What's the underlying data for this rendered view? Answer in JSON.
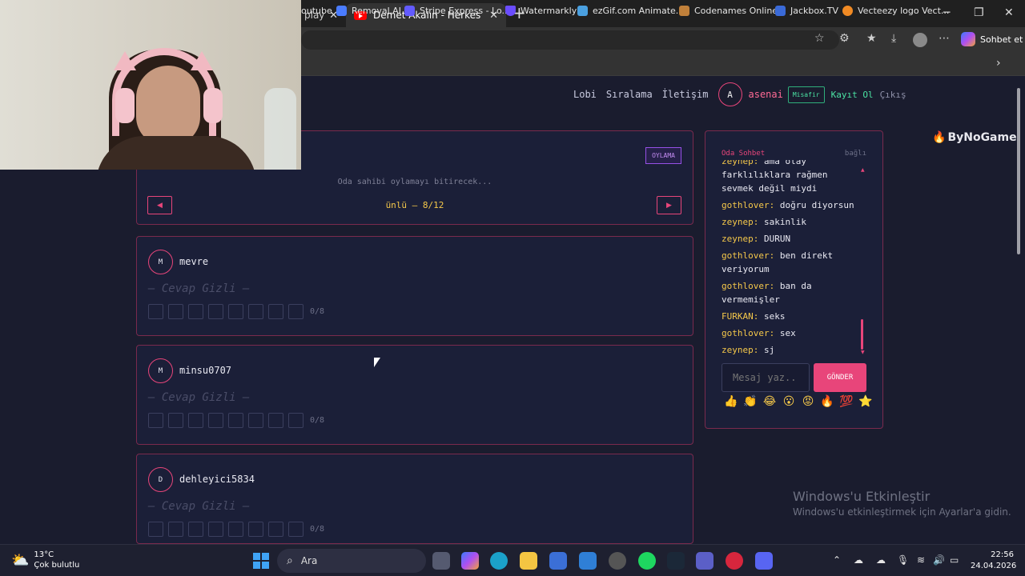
{
  "browser": {
    "tabs": [
      {
        "title": "player"
      },
      {
        "title": "Demet Akalın - Herkes Hak Ettiği G"
      }
    ],
    "copilot_label": "Sohbet et",
    "bookmarks": [
      {
        "label": "outube",
        "color": "#ff0000"
      },
      {
        "label": "Removal.AI",
        "color": "#4a7cff"
      },
      {
        "label": "Stripe Express - Lo...",
        "color": "#635bff"
      },
      {
        "label": "Watermarkly",
        "color": "#6a4cff"
      },
      {
        "label": "ezGif.com Animate...",
        "color": "#4aa0e0"
      },
      {
        "label": "Codenames Online",
        "color": "#c0803a"
      },
      {
        "label": "Jackbox.TV",
        "color": "#3a6ad8"
      },
      {
        "label": "Vecteezy logo Vect...",
        "color": "#f08a24"
      }
    ]
  },
  "nav": {
    "links": [
      "Lobi",
      "Sıralama",
      "İletişim"
    ],
    "avatar_letter": "A",
    "username": "asenai",
    "guest_badge": "Misafir",
    "register": "Kayıt Ol",
    "logout": "Çıkış",
    "logo_text": "ByNoGame"
  },
  "voting": {
    "badge": "OYLAMA",
    "status": "Oda sahibi oylamayı bitirecek...",
    "prev": "◀",
    "next": "▶",
    "counter": "ünlü — 8/12"
  },
  "players": [
    {
      "initial": "M",
      "name": "mevre",
      "answer": "— Cevap Gizli —",
      "progress": "0/8"
    },
    {
      "initial": "M",
      "name": "minsu0707",
      "answer": "— Cevap Gizli —",
      "progress": "0/8"
    },
    {
      "initial": "D",
      "name": "dehleyici5834",
      "answer": "— Cevap Gizli —",
      "progress": "0/8"
    }
  ],
  "chat": {
    "title": "Oda Sohbet",
    "status": "bağlı",
    "messages": [
      {
        "user": "zeynep:",
        "text": "ama olay farklılıklara rağmen sevmek değil miydi"
      },
      {
        "user": "gothlover:",
        "text": "doğru diyorsun"
      },
      {
        "user": "zeynep:",
        "text": "sakinlik"
      },
      {
        "user": "zeynep:",
        "text": "DURUN"
      },
      {
        "user": "gothlover:",
        "text": "ben direkt veriyorum"
      },
      {
        "user": "gothlover:",
        "text": "ban da vermemişler"
      },
      {
        "user": "FURKAN:",
        "text": "seks"
      },
      {
        "user": "gothlover:",
        "text": "sex"
      },
      {
        "user": "zeynep:",
        "text": "sj"
      }
    ],
    "input_placeholder": "Mesaj yaz..",
    "send_label": "GÖNDER",
    "emojis": [
      "👍",
      "👏",
      "😂",
      "😮",
      "😡",
      "🔥",
      "💯",
      "⭐"
    ]
  },
  "watermark": {
    "title": "Windows'u Etkinleştir",
    "subtitle": "Windows'u etkinleştirmek için Ayarlar'a gidin."
  },
  "taskbar": {
    "temperature": "13°C",
    "weather": "Çok bulutlu",
    "search_label": "Ara",
    "time": "22:56",
    "date": "24.04.2026"
  }
}
